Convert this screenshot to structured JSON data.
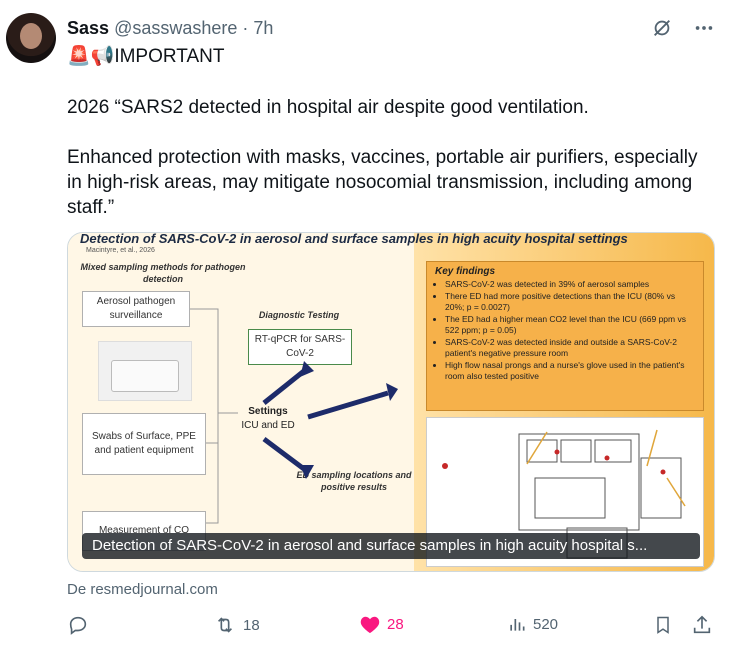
{
  "post": {
    "author_name": "Sass",
    "author_handle": "@sasswashere",
    "time_sep": "·",
    "time": "7h",
    "headline_emoji": "🚨📢",
    "headline": "IMPORTANT",
    "paragraph1": "2026 “SARS2 detected in hospital air despite good ventilation.",
    "paragraph2": "Enhanced protection with masks, vaccines, portable air purifiers, especially in high-risk areas, may mitigate nosocomial transmission, including among staff.”",
    "source": "De resmedjournal.com"
  },
  "media": {
    "caption": "Detection of SARS-CoV-2 in aerosol and surface samples in high acuity hospital s...",
    "poster_title": "Detection of SARS-CoV-2 in aerosol and surface samples in high acuity hospital settings",
    "poster_authors": "Macintyre, et al., 2026",
    "mixed_methods": "Mixed sampling methods for pathogen detection",
    "box_aerosol": "Aerosol pathogen surveillance",
    "box_swabs": "Swabs of Surface, PPE and patient equipment",
    "box_measurement": "Measurement of CO",
    "diag_label": "Diagnostic Testing",
    "box_rtpcr": "RT-qPCR for SARS-CoV-2",
    "settings_label": "Settings",
    "settings_value": "ICU and ED",
    "ed_label": "ED sampling locations and positive results",
    "key_title": "Key findings",
    "key_findings": [
      "SARS-CoV-2 was detected in 39% of aerosol samples",
      "There ED had more positive detections than the ICU (80% vs 20%; p = 0.0027)",
      "The ED had a higher mean CO2 level than the ICU (669 ppm vs 522 ppm; p = 0.05)",
      "SARS-CoV-2 was detected inside and outside a SARS-CoV-2 patient's negative pressure room",
      "High flow nasal prongs and a nurse's glove used in the patient's room also tested positive"
    ]
  },
  "actions": {
    "reply_count": "",
    "repost_count": "18",
    "like_count": "28",
    "views_count": "520"
  },
  "icons": {
    "grok": "grok-icon",
    "more": "more-icon",
    "reply": "reply-icon",
    "repost": "repost-icon",
    "like": "heart-icon",
    "views": "views-icon",
    "bookmark": "bookmark-icon",
    "share": "share-icon"
  },
  "colors": {
    "like_active": "#f91880",
    "secondary_text": "#536471",
    "primary_text": "#0f1419"
  }
}
